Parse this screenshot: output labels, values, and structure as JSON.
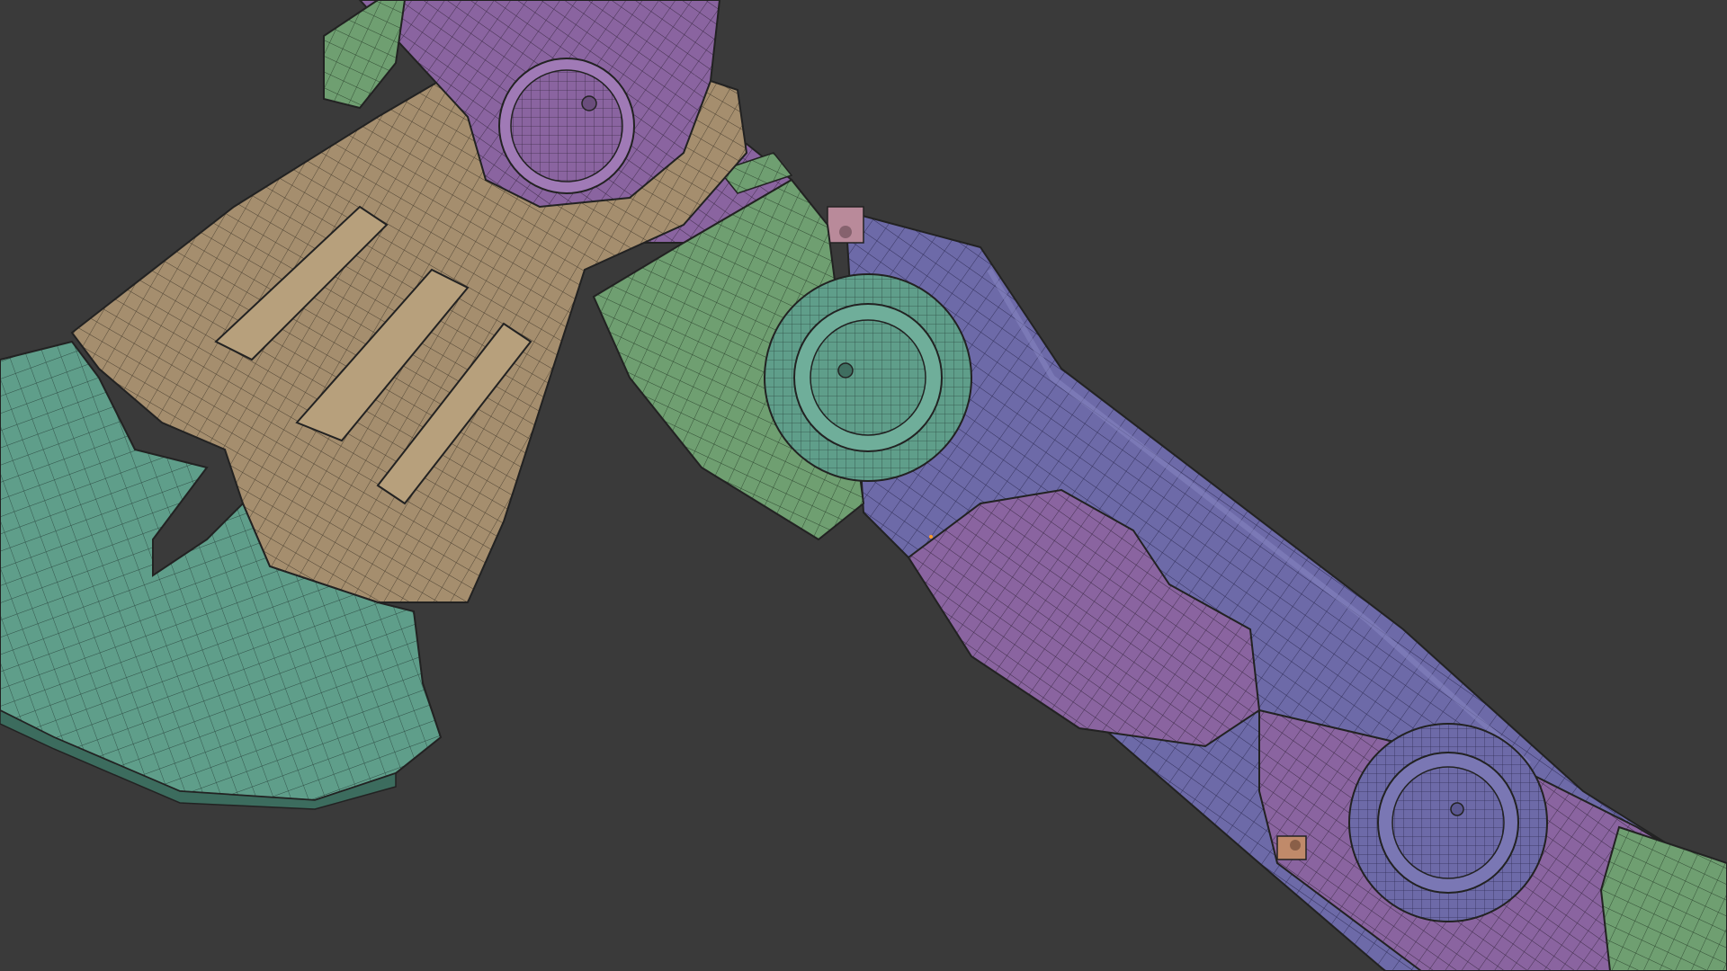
{
  "scene": {
    "background_color": "#3a3a3a",
    "wire_color": "#2a2a2a",
    "materials": {
      "beige": "#a58e6e",
      "beige_light": "#c9b18c",
      "teal": "#5f9e8a",
      "teal_light": "#7bbda8",
      "green": "#6f9f71",
      "purple": "#8a64a0",
      "purple_light": "#a07ab6",
      "violet": "#6d6aa8",
      "violet_light": "#8583c0",
      "pink": "#b98a9a",
      "orange": "#c08a6a"
    },
    "objects": [
      {
        "name": "axe-blade",
        "material": "teal"
      },
      {
        "name": "axe-head-bracket",
        "material": "beige"
      },
      {
        "name": "top-pivot-cap",
        "material": "purple"
      },
      {
        "name": "neck-collar",
        "material": "green"
      },
      {
        "name": "wheel-knob-upper",
        "material": "teal"
      },
      {
        "name": "handle-shaft",
        "material": "violet"
      },
      {
        "name": "grip-panel",
        "material": "purple"
      },
      {
        "name": "wheel-knob-lower",
        "material": "violet"
      },
      {
        "name": "lower-bracket",
        "material": "purple"
      },
      {
        "name": "small-screw-upper",
        "material": "pink"
      },
      {
        "name": "small-screw-lower",
        "material": "orange"
      }
    ]
  }
}
